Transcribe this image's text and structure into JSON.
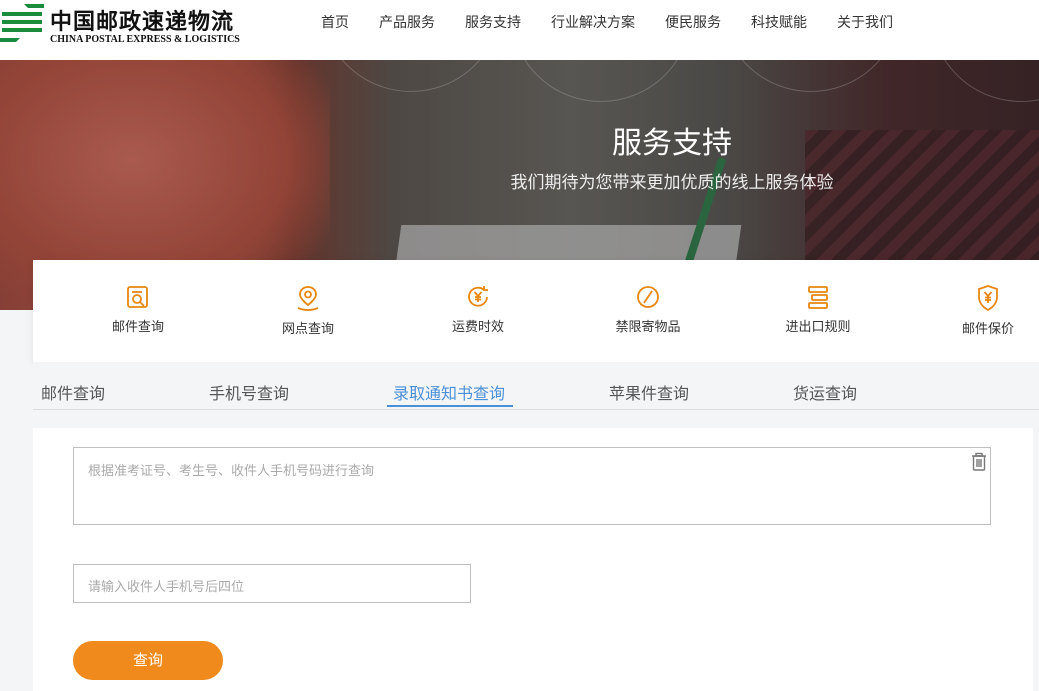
{
  "logo": {
    "cn": "中国邮政速递物流",
    "en": "CHINA POSTAL EXPRESS & LOGISTICS",
    "color": "#1a8a3c"
  },
  "nav": {
    "items": [
      "首页",
      "产品服务",
      "服务支持",
      "行业解决方案",
      "便民服务",
      "科技赋能",
      "关于我们"
    ]
  },
  "banner": {
    "title": "服务支持",
    "subtitle": "我们期待为您带来更加优质的线上服务体验"
  },
  "services": {
    "accent": "#e8860f",
    "items": [
      {
        "label": "邮件查询",
        "icon": "mail-search-icon"
      },
      {
        "label": "网点查询",
        "icon": "location-pin-icon"
      },
      {
        "label": "运费时效",
        "icon": "yuan-clock-icon"
      },
      {
        "label": "禁限寄物品",
        "icon": "prohibited-icon"
      },
      {
        "label": "进出口规则",
        "icon": "rules-icon"
      },
      {
        "label": "邮件保价",
        "icon": "shield-yuan-icon"
      }
    ]
  },
  "tabs": {
    "items": [
      "邮件查询",
      "手机号查询",
      "录取通知书查询",
      "苹果件查询",
      "货运查询"
    ],
    "active": "录取通知书查询",
    "active_color": "#4a90d9"
  },
  "form": {
    "query_placeholder": "根据准考证号、考生号、收件人手机号码进行查询",
    "phone_placeholder": "请输入收件人手机号后四位",
    "submit_label": "查询",
    "button_color": "#f08a1c"
  }
}
